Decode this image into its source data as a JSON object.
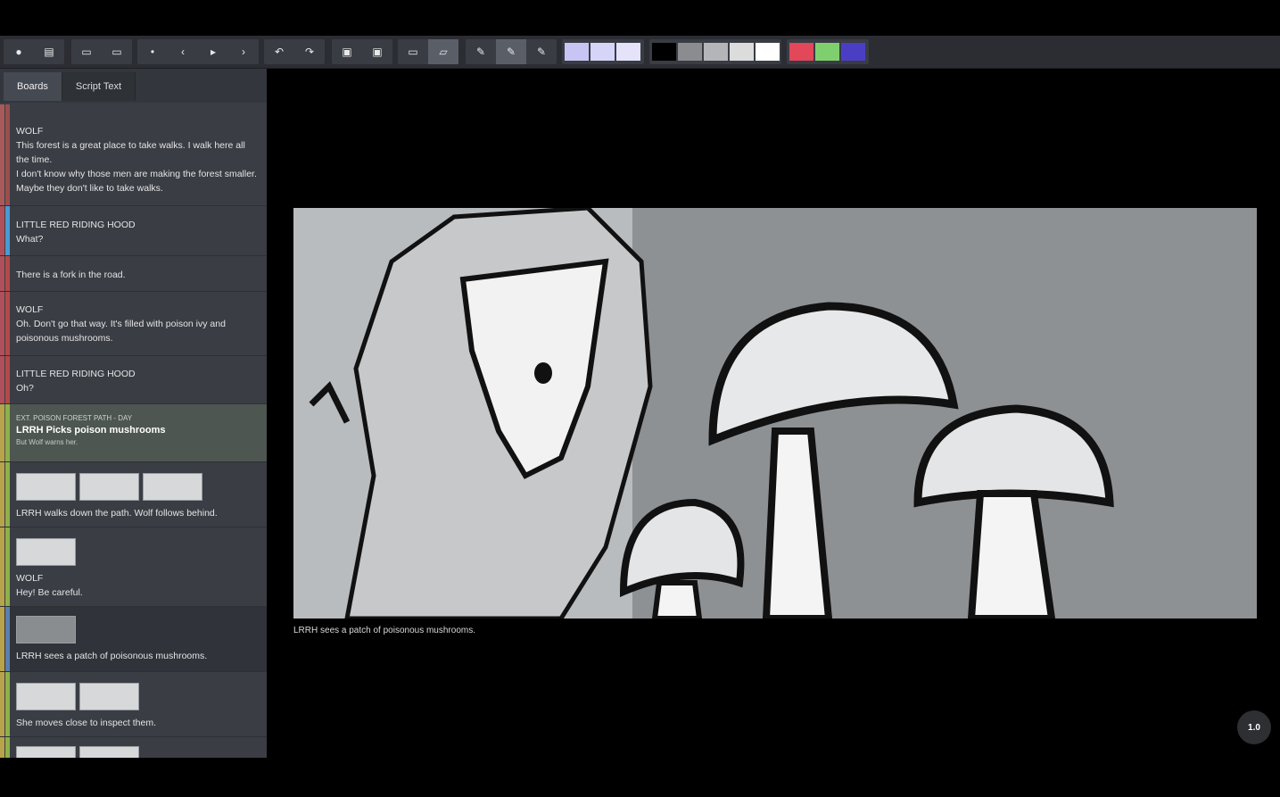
{
  "toolbar": {
    "colors_light": [
      "#c8c5f5",
      "#d6d4f7",
      "#e4e3fa"
    ],
    "colors_gray": [
      "#000000",
      "#8a8c90",
      "#b3b5b8",
      "#dcdcdd",
      "#ffffff"
    ],
    "colors_accent": [
      "#e2475a",
      "#7fcf6e",
      "#4a3fc4"
    ]
  },
  "sidebar": {
    "tabs": [
      {
        "label": "Boards"
      },
      {
        "label": "Script Text"
      }
    ],
    "rows": [
      {
        "speaker": "WOLF",
        "text": "This forest is a great place to take walks. I walk here all the time.",
        "text2": "I don't know why those men are making the forest smaller. Maybe they don't like to take walks.",
        "color": "#a85a5a",
        "color2": "#9a4f4f"
      },
      {
        "speaker": "LITTLE RED RIDING HOOD",
        "text": "What?",
        "color": "#b0505a",
        "color2": "#4a9ad4"
      },
      {
        "text": "There is a fork in the road.",
        "color": "#b0505a",
        "color2": "#b24a4a"
      },
      {
        "speaker": "WOLF",
        "text": "Oh. Don't go that way. It's filled with poison ivy and poisonous mushrooms.",
        "color": "#b0505a",
        "color2": "#b24a4a"
      },
      {
        "speaker": "LITTLE RED RIDING HOOD",
        "text": "Oh?",
        "color": "#b0505a",
        "color2": "#b24a4a"
      }
    ],
    "scene": {
      "heading": "EXT. POISON FOREST PATH - DAY",
      "title": "LRRH Picks poison mushrooms",
      "sub": "But Wolf warns her."
    },
    "boards": [
      {
        "text": "LRRH walks down the path. Wolf follows behind.",
        "thumbs": 3
      },
      {
        "speaker": "WOLF",
        "text": "Hey! Be careful.",
        "thumbs": 1
      },
      {
        "text": "LRRH sees a patch of poisonous mushrooms.",
        "thumbs": 1
      },
      {
        "text": "She moves close to inspect them.",
        "thumbs": 2
      }
    ]
  },
  "main": {
    "caption": "LRRH sees a patch of poisonous mushrooms.",
    "zoom": "1.0"
  }
}
